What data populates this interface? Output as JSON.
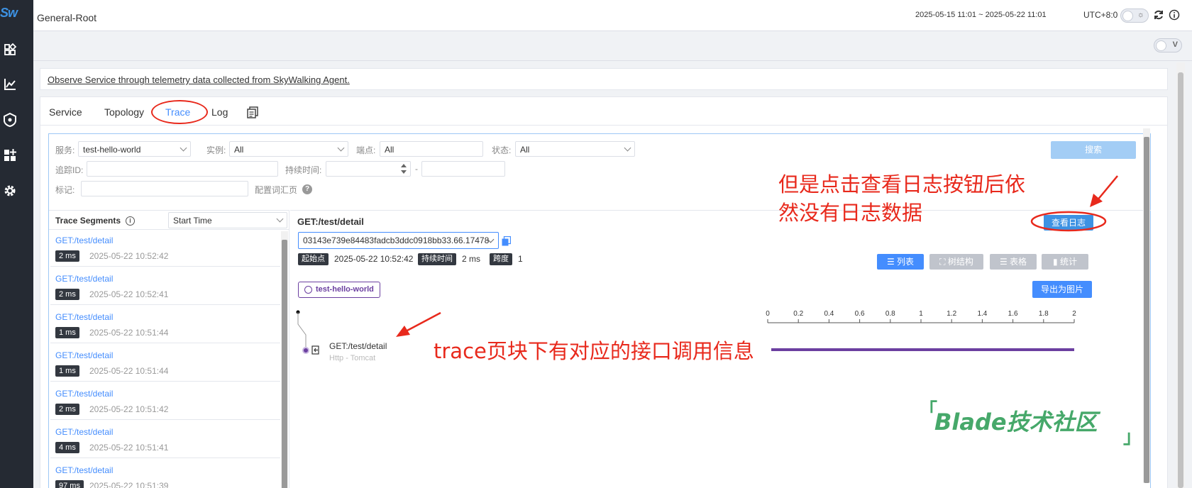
{
  "sidebar": {
    "logo": "Sw",
    "icons": [
      "dashboard-icon",
      "chart-icon",
      "shield-icon",
      "widgets-icon",
      "gear-icon"
    ]
  },
  "header": {
    "title": "General-Root",
    "time_range": "2025-05-15 11:01 ~ 2025-05-22 11:01",
    "timezone": "UTC+8:0",
    "theme_glyph": "☼"
  },
  "subbar": {
    "toggle_label": "V"
  },
  "banner": {
    "text": "Observe Service through telemetry data collected from SkyWalking Agent."
  },
  "tabs": [
    {
      "label": "Service",
      "active": false
    },
    {
      "label": "Topology",
      "active": false
    },
    {
      "label": "Trace",
      "active": true
    },
    {
      "label": "Log",
      "active": false
    }
  ],
  "filters": {
    "service_label": "服务:",
    "service_value": "test-hello-world",
    "instance_label": "实例:",
    "instance_value": "All",
    "endpoint_label": "端点:",
    "endpoint_value": "All",
    "status_label": "状态:",
    "status_value": "All",
    "traceid_label": "追踪ID:",
    "duration_label": "持续时间:",
    "duration_sep": "-",
    "tags_label": "标记:",
    "vocab_label": "配置词汇页",
    "search_button": "搜索"
  },
  "segments": {
    "header": "Trace Segments",
    "info_glyph": "i",
    "sort_value": "Start Time",
    "items": [
      {
        "name": "GET:/test/detail",
        "duration": "2 ms",
        "time": "2025-05-22 10:52:42"
      },
      {
        "name": "GET:/test/detail",
        "duration": "2 ms",
        "time": "2025-05-22 10:52:41"
      },
      {
        "name": "GET:/test/detail",
        "duration": "1 ms",
        "time": "2025-05-22 10:51:44"
      },
      {
        "name": "GET:/test/detail",
        "duration": "1 ms",
        "time": "2025-05-22 10:51:44"
      },
      {
        "name": "GET:/test/detail",
        "duration": "2 ms",
        "time": "2025-05-22 10:51:42"
      },
      {
        "name": "GET:/test/detail",
        "duration": "4 ms",
        "time": "2025-05-22 10:51:41"
      },
      {
        "name": "GET:/test/detail",
        "duration": "97 ms",
        "time": "2025-05-22 10:51:39"
      }
    ]
  },
  "detail": {
    "title": "GET:/test/detail",
    "trace_id": "03143e739e84483fadcb3ddc0918bb33.66.17478",
    "start_label": "起始点",
    "start_value": "2025-05-22 10:52:42",
    "duration_label": "持续时间",
    "duration_value": "2 ms",
    "span_label": "跨度",
    "span_value": "1",
    "log_button": "查看日志",
    "view_buttons": [
      {
        "label": "列表",
        "active": true
      },
      {
        "label": "树结构",
        "active": false
      },
      {
        "label": "表格",
        "active": false
      },
      {
        "label": "统计",
        "active": false
      }
    ],
    "export_button": "导出为图片",
    "service_tag": "test-hello-world",
    "axis_ticks": [
      "0",
      "0.2",
      "0.4",
      "0.6",
      "0.8",
      "1",
      "1.2",
      "1.4",
      "1.6",
      "1.8",
      "2"
    ],
    "span": {
      "name": "GET:/test/detail",
      "sub": "Http - Tomcat",
      "start": 0,
      "end": 2
    }
  },
  "annotations": {
    "top_text_line1": "但是点击查看日志按钮后依",
    "top_text_line2": "然没有日志数据",
    "bottom_text": "trace页块下有对应的接口调用信息",
    "color": "#e8291c"
  },
  "watermark": {
    "text": "Blade技术社区",
    "open": "「",
    "close": "」"
  },
  "colors": {
    "accent": "#448dfe",
    "sidebar": "#252a33",
    "span_bar": "#6b3fa0",
    "annotation": "#e8291c",
    "watermark": "#46a86a"
  }
}
